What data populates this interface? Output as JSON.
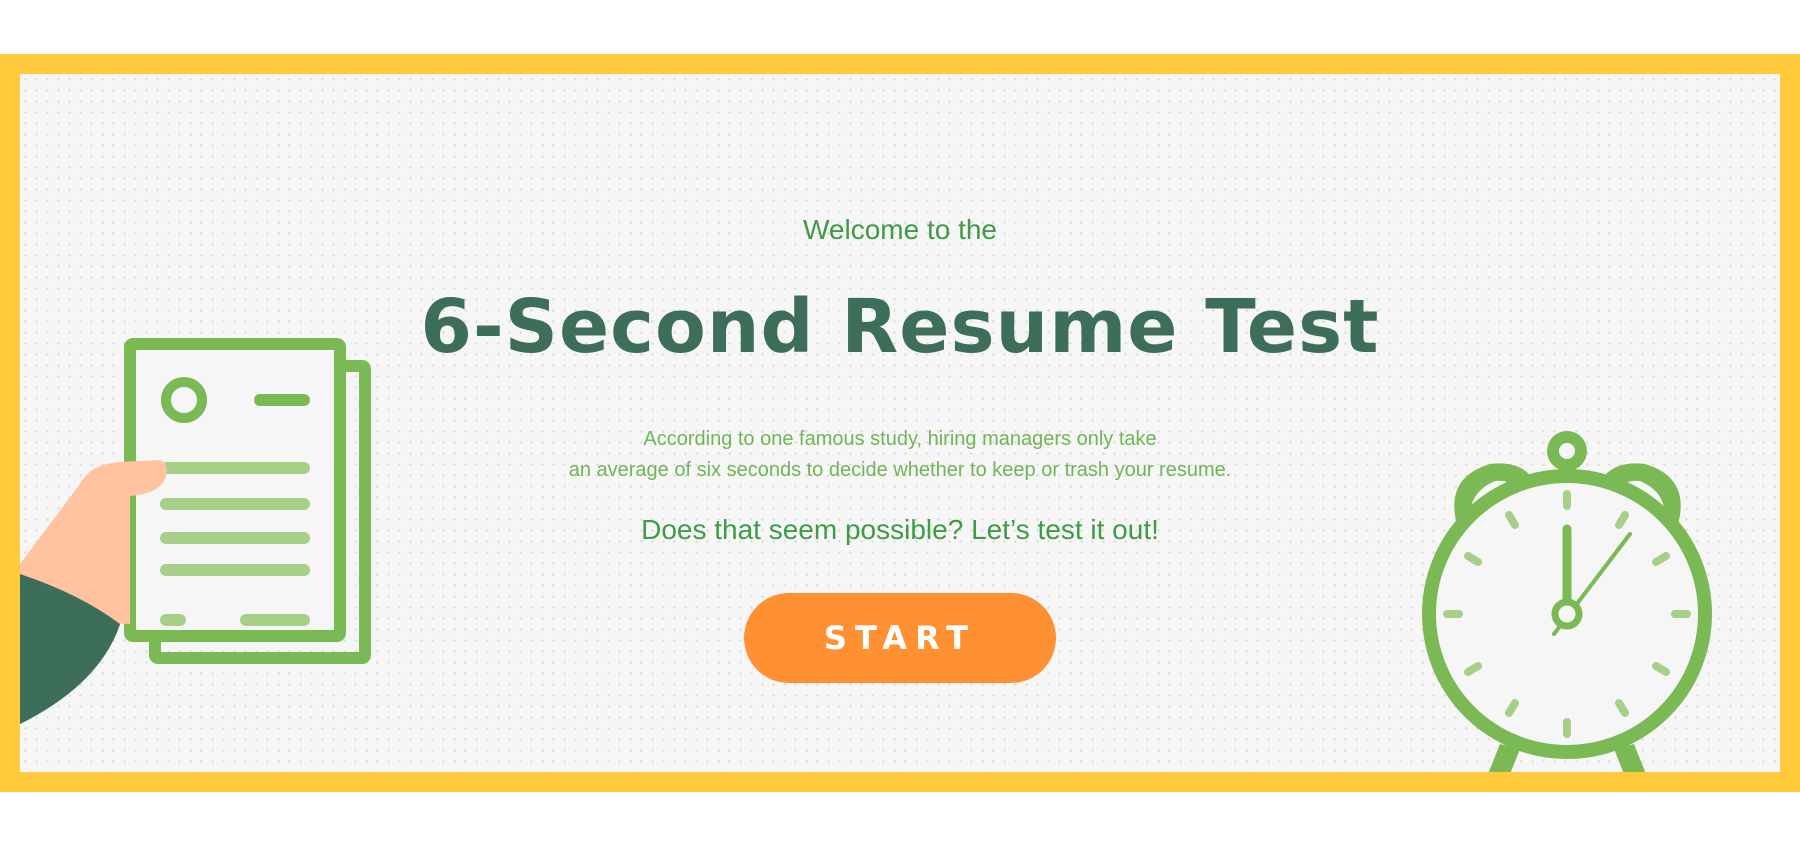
{
  "hero": {
    "welcome": "Welcome to the",
    "title": "6-Second Resume Test",
    "description_line1": "According to one famous study, hiring managers only take",
    "description_line2": "an average of six seconds to decide whether to keep or trash your resume.",
    "question": "Does that seem possible? Let’s test it out!",
    "start_label": "START"
  },
  "colors": {
    "frame": "#ffcb3d",
    "title": "#3d6e59",
    "accent_green": "#7bb955",
    "button": "#ff9133"
  },
  "icons": {
    "left": "resume-in-hand-icon",
    "right": "alarm-clock-icon"
  }
}
